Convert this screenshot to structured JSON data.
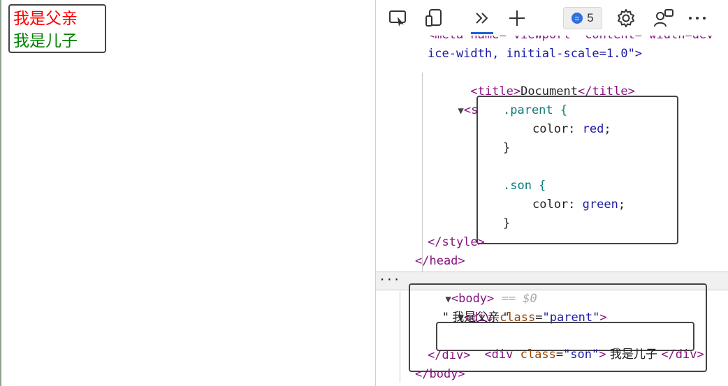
{
  "viewport": {
    "parent_text": "我是父亲",
    "son_text": "我是儿子",
    "colors": {
      "parent": "#ff0000",
      "son": "#008000"
    }
  },
  "toolbar": {
    "icons": [
      "inspect-icon",
      "device-emulation-icon",
      "more-tools-icon",
      "add-tab-icon",
      "issues-icon",
      "settings-icon",
      "feedback-icon",
      "more-options-icon"
    ],
    "issues_count": "5"
  },
  "code": {
    "meta_line_a": "<meta name=\"viewport\" content=\"width=dev",
    "meta_line_b": "ice-width, initial-scale=1.0\">",
    "title_open": "<title>",
    "title_text": "Document",
    "title_close": "</title>",
    "style_open": "<style>",
    "style_close": "</style>",
    "head_close": "</head>",
    "body_open": "<body>",
    "body_marker": "== $0",
    "row_ellipsis": "···",
    "div_open_tag": "<div",
    "class_attr": "class",
    "eq": "=",
    "parent_class": "\"parent\"",
    "gt": ">",
    "parent_text": "\" 我是父亲 \"",
    "son_class": "\"son\"",
    "son_text": " 我是儿子 ",
    "div_close": "</div>",
    "body_close": "</body>"
  },
  "css": {
    "parent_selector": ".parent {",
    "parent_prop": "color:",
    "parent_val": "red",
    "semi": ";",
    "close_brace": "}",
    "son_selector": ".son {",
    "son_prop": "color:",
    "son_val": "green"
  }
}
